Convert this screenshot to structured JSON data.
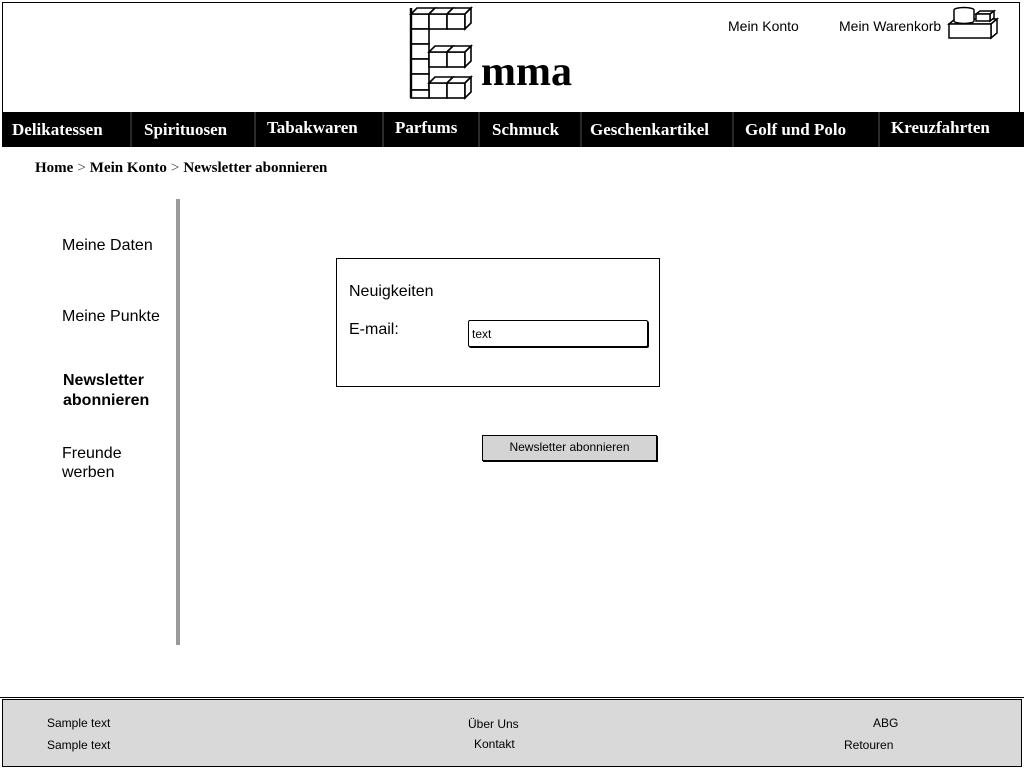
{
  "header": {
    "logo_text": "mma",
    "account_link": "Mein Konto",
    "cart_link": "Mein Warenkorb"
  },
  "nav": {
    "items": [
      "Delikatessen",
      "Spirituosen",
      "Tabakwaren",
      "Parfums",
      "Schmuck",
      "Geschenkartikel",
      "Golf und Polo",
      "Kreuzfahrten"
    ]
  },
  "breadcrumb": {
    "items": [
      "Home",
      "Mein Konto",
      "Newsletter abonnieren"
    ],
    "separator": ">"
  },
  "sidebar": {
    "items": [
      {
        "label": "Meine Daten"
      },
      {
        "label": "Meine Punkte"
      },
      {
        "label_line1": "Newsletter",
        "label_line2": "abonnieren",
        "active": true
      },
      {
        "label_line1": "Freunde",
        "label_line2": "werben"
      }
    ]
  },
  "newsletter": {
    "title": "Neuigkeiten",
    "email_label": "E-mail:",
    "email_placeholder": "text",
    "submit_label": "Newsletter abonnieren"
  },
  "footer": {
    "col1": [
      "Sample text",
      "Sample text"
    ],
    "col2": [
      "Über Uns",
      "Kontakt"
    ],
    "col3": [
      "ABG",
      "Retouren"
    ]
  },
  "icons": {
    "logo": "block-letter-e-logo",
    "cart": "cart-icon"
  },
  "colors": {
    "nav_background": "#000000",
    "nav_text": "#ffffff",
    "footer_background": "#d9d9d9",
    "button_background": "#d4d4d4",
    "sidebar_divider": "#9a9a9a"
  }
}
